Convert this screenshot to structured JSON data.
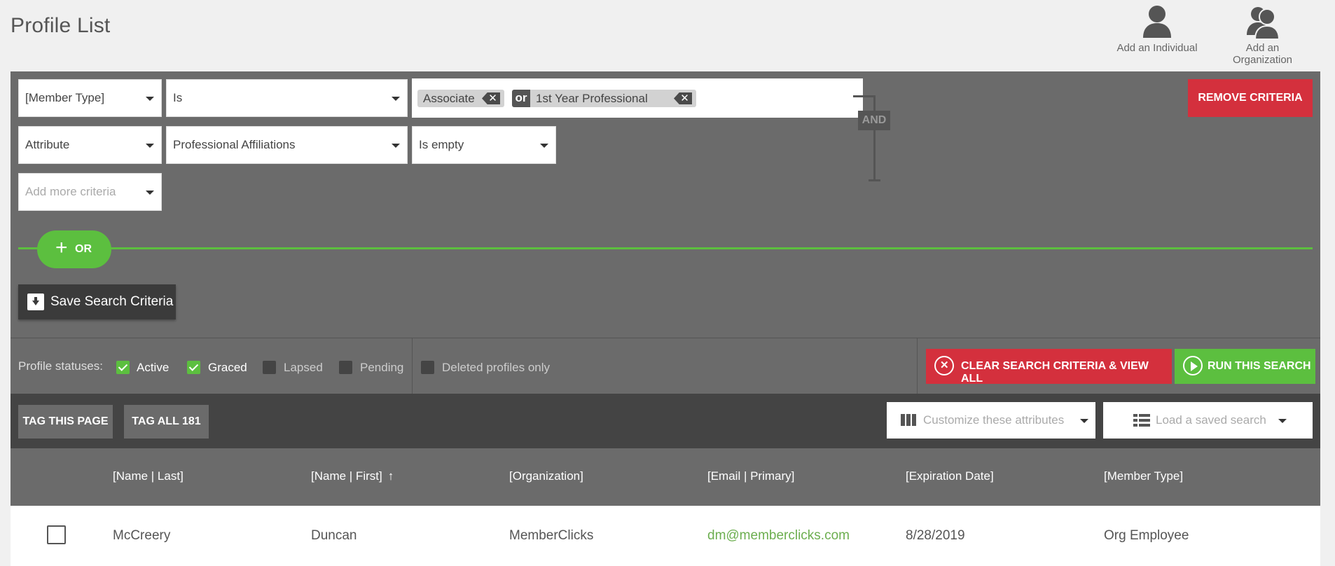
{
  "page": {
    "title": "Profile List"
  },
  "header_actions": {
    "add_individual": "Add an Individual",
    "add_organization": "Add an Organization"
  },
  "criteria": {
    "row1": {
      "field": "[Member Type]",
      "operator": "Is",
      "values": [
        "Associate",
        "1st Year Professional"
      ],
      "joiner": "or"
    },
    "row2": {
      "field": "Attribute",
      "attribute": "Professional Affiliations",
      "operator": "Is empty"
    },
    "add_more_placeholder": "Add more criteria",
    "and_label": "AND",
    "remove_label": "REMOVE CRITERIA",
    "or_button_label": "OR",
    "save_label": "Save Search Criteria"
  },
  "statuses": {
    "label": "Profile statuses:",
    "items": [
      {
        "label": "Active",
        "checked": true
      },
      {
        "label": "Graced",
        "checked": true
      },
      {
        "label": "Lapsed",
        "checked": false
      },
      {
        "label": "Pending",
        "checked": false
      }
    ],
    "deleted_label": "Deleted profiles only",
    "clear_label": "CLEAR SEARCH CRITERIA & VIEW ALL",
    "run_label": "RUN THIS SEARCH"
  },
  "toolbar": {
    "tag_page": "TAG THIS PAGE",
    "tag_all": "TAG ALL 181",
    "customize_placeholder": "Customize these attributes",
    "load_search_placeholder": "Load a saved search"
  },
  "table": {
    "columns": [
      "[Name | Last]",
      "[Name | First]",
      "[Organization]",
      "[Email | Primary]",
      "[Expiration Date]",
      "[Member Type]"
    ],
    "sorted_column": "[Name | First]",
    "sort_direction": "ascending",
    "rows": [
      [
        "McCreery",
        "Duncan",
        "MemberClicks",
        "dm@memberclicks.com",
        "8/28/2019",
        "Org Employee"
      ]
    ]
  },
  "colors": {
    "accent_green": "#5cbf3f",
    "danger_red": "#d4303d",
    "panel_gray": "#6b6b6b",
    "link_green": "#6cae4f"
  }
}
